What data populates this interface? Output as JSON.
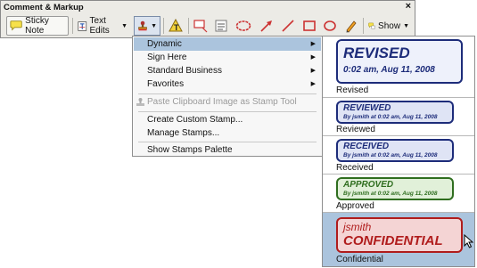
{
  "panel": {
    "title": "Comment & Markup",
    "close": "×",
    "toolbar": {
      "sticky_note": "Sticky Note",
      "text_edits": "Text Edits",
      "show": "Show"
    }
  },
  "menu": {
    "items": [
      {
        "label": "Dynamic"
      },
      {
        "label": "Sign Here"
      },
      {
        "label": "Standard Business"
      },
      {
        "label": "Favorites"
      },
      {
        "label": "Paste Clipboard Image as Stamp Tool"
      },
      {
        "label": "Create Custom Stamp..."
      },
      {
        "label": "Manage Stamps..."
      },
      {
        "label": "Show Stamps Palette"
      }
    ]
  },
  "stamps": [
    {
      "line1": "REVISED",
      "line2": "0:02 am, Aug 11, 2008",
      "label": "Revised",
      "color": "#1d2c7a",
      "bg": "#eef1fb"
    },
    {
      "line1": "REVIEWED",
      "line2": "By jsmith at 0:02 am, Aug 11, 2008",
      "label": "Reviewed",
      "color": "#1d2c7a",
      "bg": "#dfe4f5"
    },
    {
      "line1": "RECEIVED",
      "line2": "By jsmith at 0:02 am, Aug 11, 2008",
      "label": "Received",
      "color": "#1d2c7a",
      "bg": "#dfe4f5"
    },
    {
      "line1": "APPROVED",
      "line2": "By jsmith at 0:02 am, Aug 11, 2008",
      "label": "Approved",
      "color": "#2f6e1f",
      "bg": "#e1f0d9"
    },
    {
      "line1": "jsmith",
      "line2": "CONFIDENTIAL",
      "label": "Confidential",
      "color": "#b01c1c",
      "bg": "#f4d4d4"
    }
  ]
}
